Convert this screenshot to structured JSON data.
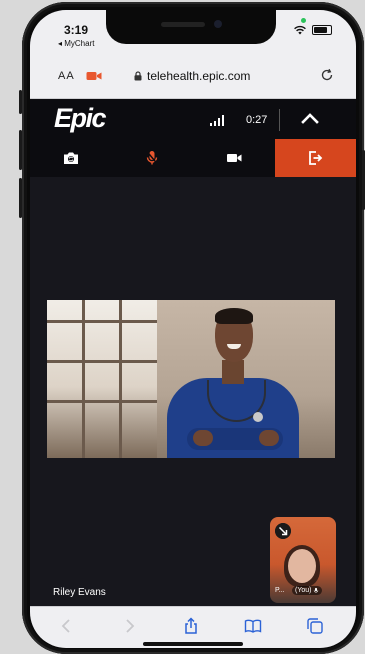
{
  "status_bar": {
    "time": "3:19",
    "back_app": "◂ MyChart"
  },
  "browser": {
    "text_size_label": "AA",
    "url": "telehealth.epic.com",
    "camera_indicator_color": "#e8572f"
  },
  "visit_header": {
    "logo_text": "Epic",
    "call_duration": "0:27"
  },
  "controls": {
    "accent_color": "#d6461e",
    "mute_icon_color": "#e8572f",
    "items": [
      {
        "name": "switch-camera",
        "icon": "camera-flip-icon"
      },
      {
        "name": "microphone",
        "icon": "microphone-icon"
      },
      {
        "name": "video",
        "icon": "video-camera-icon"
      },
      {
        "name": "leave-call",
        "icon": "exit-icon"
      }
    ]
  },
  "video": {
    "remote_participant_name": "Riley Evans",
    "self_view": {
      "name_initial": "P...",
      "you_label": "(You)"
    }
  }
}
